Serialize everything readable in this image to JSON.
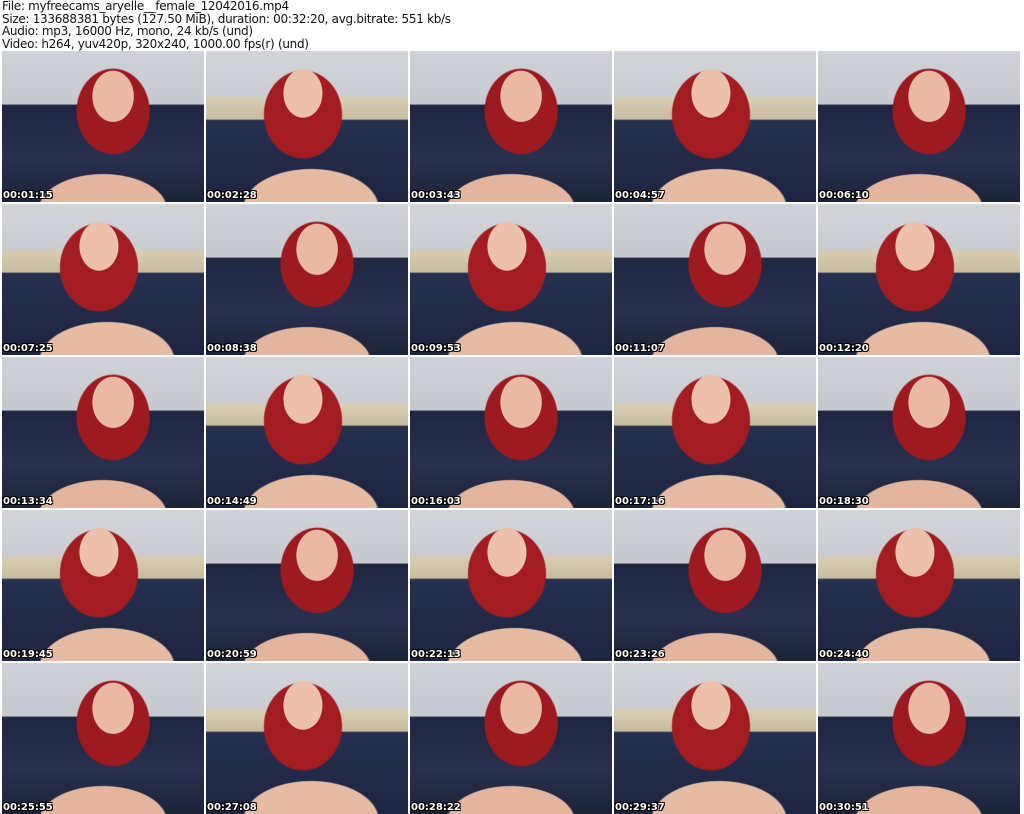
{
  "header": {
    "file": "File: myfreecams_aryelle__female_12042016.mp4",
    "size": "Size: 133688381 bytes (127.50 MiB), duration: 00:32:20, avg.bitrate: 551 kb/s",
    "audio": "Audio: mp3, 16000 Hz, mono, 24 kb/s (und)",
    "video": "Video: h264, yuv420p, 320x240, 1000.00 fps(r) (und)"
  },
  "thumbnails": [
    "00:01:15",
    "00:02:28",
    "00:03:43",
    "00:04:57",
    "00:06:10",
    "00:07:25",
    "00:08:38",
    "00:09:53",
    "00:11:07",
    "00:12:20",
    "00:13:34",
    "00:14:49",
    "00:16:03",
    "00:17:16",
    "00:18:30",
    "00:19:45",
    "00:20:59",
    "00:22:13",
    "00:23:26",
    "00:24:40",
    "00:25:55",
    "00:27:08",
    "00:28:22",
    "00:29:37",
    "00:30:51"
  ]
}
